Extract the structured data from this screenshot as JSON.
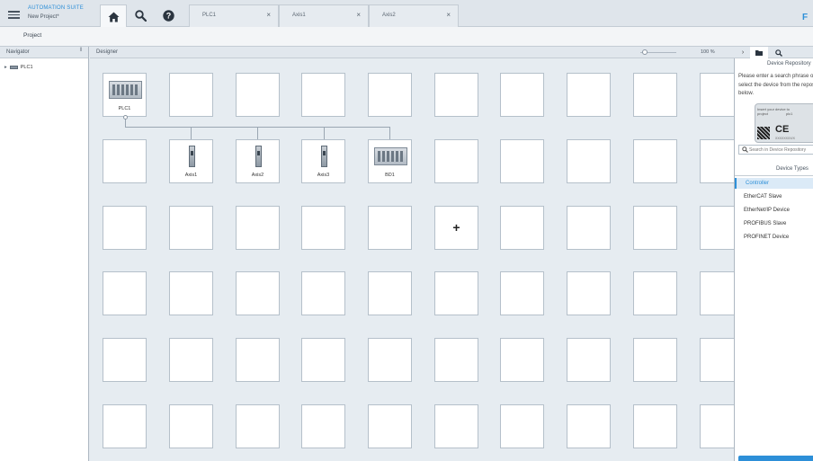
{
  "header": {
    "app_title": "AUTOMATION SUITE",
    "project_name": "New Project*",
    "logo_fragment": "F",
    "tabs": [
      {
        "label": "PLC1"
      },
      {
        "label": "Axis1"
      },
      {
        "label": "Axis2"
      }
    ],
    "close_glyph": "×"
  },
  "ribbon": {
    "project_tab": "Project"
  },
  "navigator": {
    "title": "Navigator",
    "pin_glyph": "ǁ",
    "tree": [
      {
        "expander": "▸",
        "label": "PLC1"
      }
    ]
  },
  "designer": {
    "title": "Designer",
    "zoom_label": "100 %",
    "devices": [
      "PLC1",
      "Axis1",
      "Axis2",
      "Axis3",
      "BD1"
    ],
    "plus_glyph": "+"
  },
  "side_strip": {
    "collapse_glyph": "›"
  },
  "repository": {
    "title": "Device Repository",
    "hint_lines": [
      "Please enter a search phrase or",
      "select the device from the repository",
      "below."
    ],
    "card_line1": "Insert your device to",
    "card_line2": "project",
    "card_line3": "plc1",
    "card_ce": "CE",
    "card_small": "XXXXXXXX/X",
    "search_placeholder": "Search in Device Repository",
    "types_header": "Device Types",
    "types": [
      {
        "label": "Controller",
        "selected": true
      },
      {
        "label": "EtherCAT Slave",
        "selected": false
      },
      {
        "label": "EtherNet/IP Device",
        "selected": false
      },
      {
        "label": "PROFIBUS Slave",
        "selected": false
      },
      {
        "label": "PROFINET Device",
        "selected": false
      }
    ]
  },
  "colors": {
    "accent": "#2d8fd8",
    "panel_bg": "#e6ecf1",
    "cell_border": "#b5c0ca"
  }
}
